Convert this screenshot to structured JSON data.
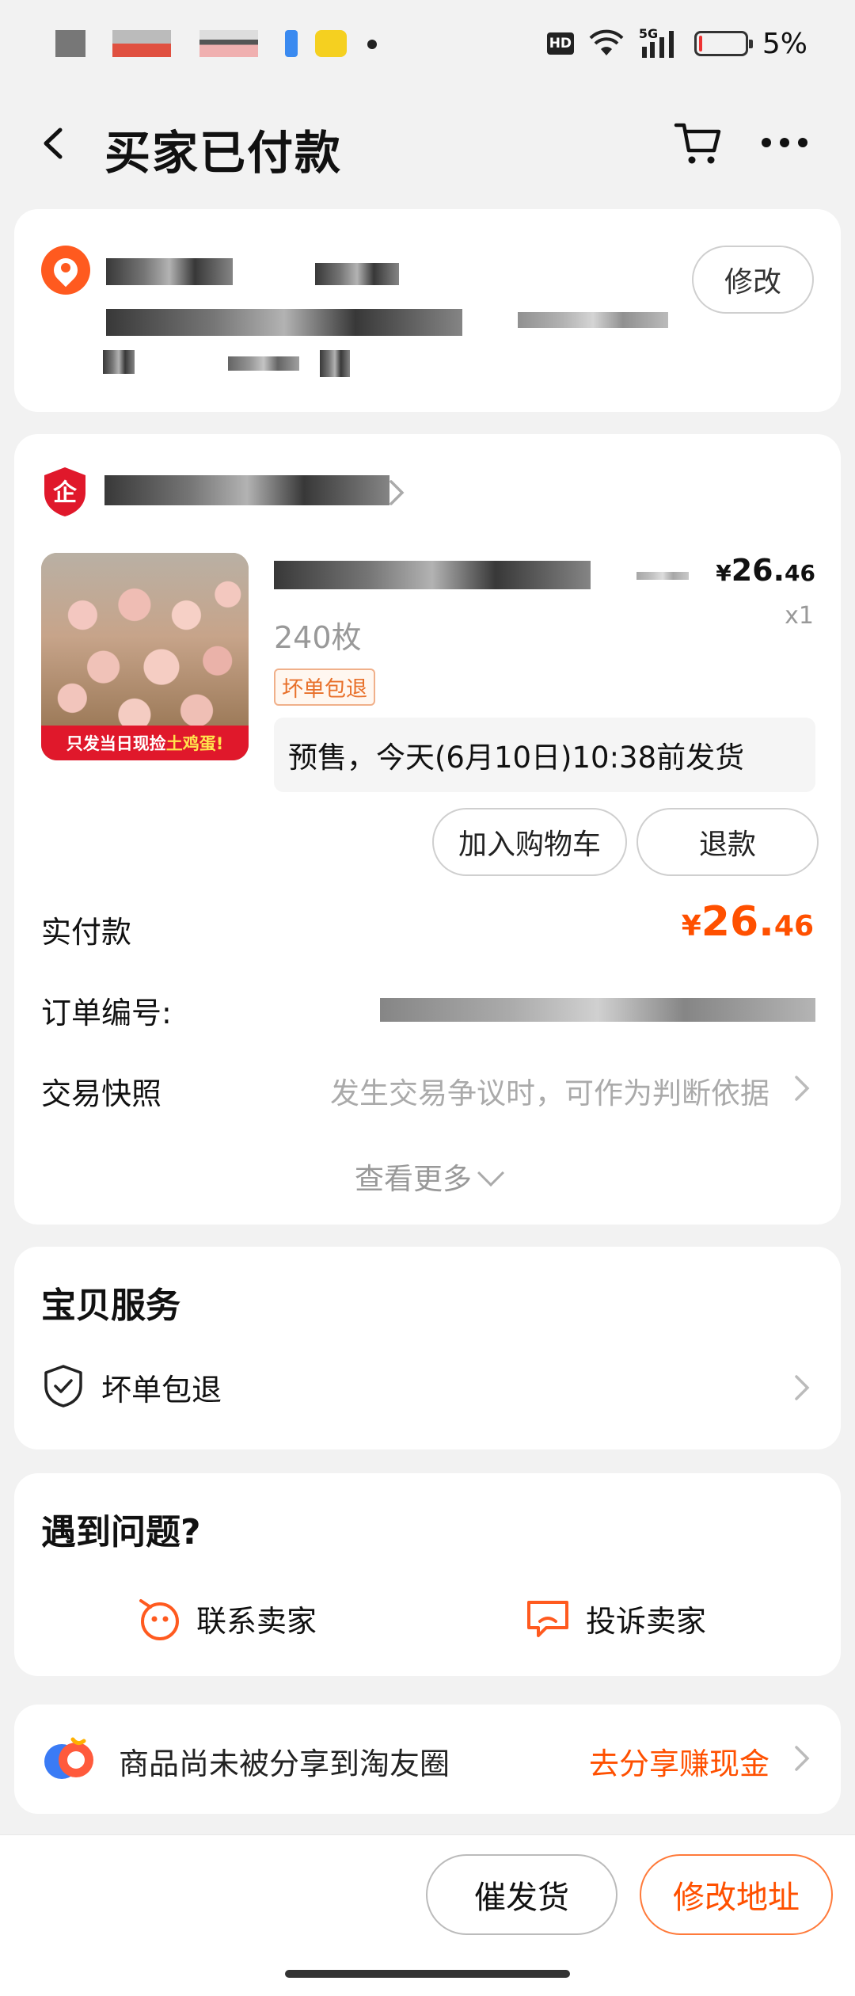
{
  "status_bar": {
    "battery": "5%",
    "signal": "5G",
    "hd": "HD",
    "battery_level": 0.05
  },
  "nav": {
    "title": "买家已付款"
  },
  "address": {
    "edit_label": "修改"
  },
  "order": {
    "product": {
      "price_symbol": "¥",
      "price_int": "26.",
      "price_dec": "46",
      "quantity": "x1",
      "spec": "240枚",
      "tag": "坏单包退",
      "image_banner_pre": "只发当日现捡",
      "image_banner_highlight": "土鸡蛋!",
      "presale": "预售，今天(6月10日)10:38前发货"
    },
    "buttons": {
      "add_to_cart": "加入购物车",
      "refund": "退款"
    },
    "rows": {
      "paid_label": "实付款",
      "paid_symbol": "¥",
      "paid_int": "26.",
      "paid_dec": "46",
      "order_no_label": "订单编号:",
      "snapshot_label": "交易快照",
      "snapshot_hint": "发生交易争议时，可作为判断依据"
    },
    "see_more": "查看更多"
  },
  "service": {
    "title": "宝贝服务",
    "item": "坏单包退"
  },
  "help": {
    "title": "遇到问题?",
    "contact": "联系卖家",
    "complain": "投诉卖家"
  },
  "share": {
    "text": "商品尚未被分享到淘友圈",
    "link": "去分享赚现金"
  },
  "bottom": {
    "urge": "催发货",
    "modify_address": "修改地址"
  },
  "colors": {
    "accent": "#ff5000",
    "background": "#f2f2f2",
    "card": "#ffffff",
    "location_icon": "#ff5a1f",
    "shop_badge": "#e0182b"
  },
  "icons": [
    "back-icon",
    "cart-icon",
    "more-icon",
    "location-icon",
    "enterprise-shop-icon",
    "chevron-right-icon",
    "shield-check-icon",
    "chat-face-icon",
    "complain-icon",
    "taoyouquan-logo"
  ]
}
